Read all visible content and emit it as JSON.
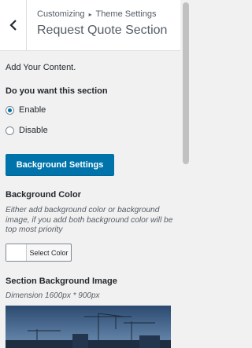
{
  "header": {
    "breadcrumb_parent": "Customizing",
    "breadcrumb_separator": "▸",
    "breadcrumb_current": "Theme Settings",
    "title": "Request Quote Section",
    "back_icon": "chevron-left-icon"
  },
  "content": {
    "intro": "Add Your Content.",
    "section_question": "Do you want this section",
    "options": [
      {
        "label": "Enable",
        "checked": true
      },
      {
        "label": "Disable",
        "checked": false
      }
    ],
    "background_settings_button": "Background Settings",
    "background_color": {
      "heading": "Background Color",
      "description": "Either add background color or background image, if you add both background color will be top most priority",
      "button_label": "Select Color",
      "current_color": "#ffffff"
    },
    "background_image": {
      "heading": "Section Background Image",
      "dimension": "Dimension 1600px * 900px"
    }
  },
  "colors": {
    "accent": "#0073aa",
    "panel_bg": "#f1f1f1"
  }
}
